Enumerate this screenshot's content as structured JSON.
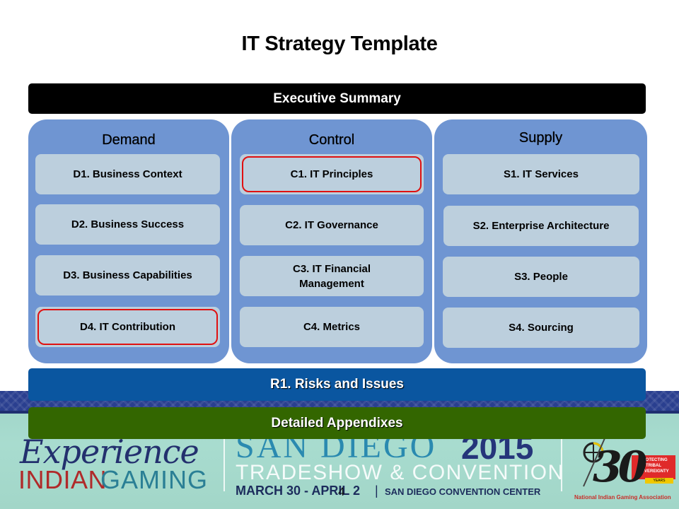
{
  "slide": {
    "title": "IT Strategy Template",
    "page_number": "4"
  },
  "executive_summary": {
    "label": "Executive Summary",
    "color": "#000000"
  },
  "columns": [
    {
      "title": "Demand",
      "items": [
        {
          "label": "D1. Business Context",
          "highlighted": false
        },
        {
          "label": "D2. Business Success",
          "highlighted": false
        },
        {
          "label": "D3. Business Capabilities",
          "highlighted": false
        },
        {
          "label": "D4. IT Contribution",
          "highlighted": true
        }
      ]
    },
    {
      "title": "Control",
      "items": [
        {
          "label": "C1. IT Principles",
          "highlighted": true
        },
        {
          "label": "C2. IT Governance",
          "highlighted": false
        },
        {
          "label": "C3. IT Financial Management",
          "highlighted": false
        },
        {
          "label": "C4. Metrics",
          "highlighted": false
        }
      ]
    },
    {
      "title": "Supply",
      "items": [
        {
          "label": "S1. IT Services",
          "highlighted": false
        },
        {
          "label": "S2. Enterprise Architecture",
          "highlighted": false
        },
        {
          "label": "S3. People",
          "highlighted": false
        },
        {
          "label": "S4. Sourcing",
          "highlighted": false
        }
      ]
    }
  ],
  "risks": {
    "label": "R1. Risks and Issues",
    "color": "#0a56a0"
  },
  "appendixes": {
    "label": "Detailed Appendixes",
    "color": "#336600"
  },
  "colors": {
    "panel": "#6f95d2",
    "box": "#bccfdd",
    "highlight": "#e01010"
  },
  "banner": {
    "script_word": "Experience",
    "indian": "INDIAN",
    "gaming": "GAMING",
    "city": "SAN DIEGO",
    "year": "2015",
    "event": "TRADESHOW & CONVENTION",
    "dates": "MARCH 30 - APRIL 2",
    "separator": "|",
    "venue": "SAN DIEGO CONVENTION CENTER",
    "logo_number": "30",
    "logo_tagline": "PROTECTING TRIBAL SOVEREIGNTY",
    "logo_years": "YEARS",
    "logo_org": "National Indian Gaming Association"
  }
}
